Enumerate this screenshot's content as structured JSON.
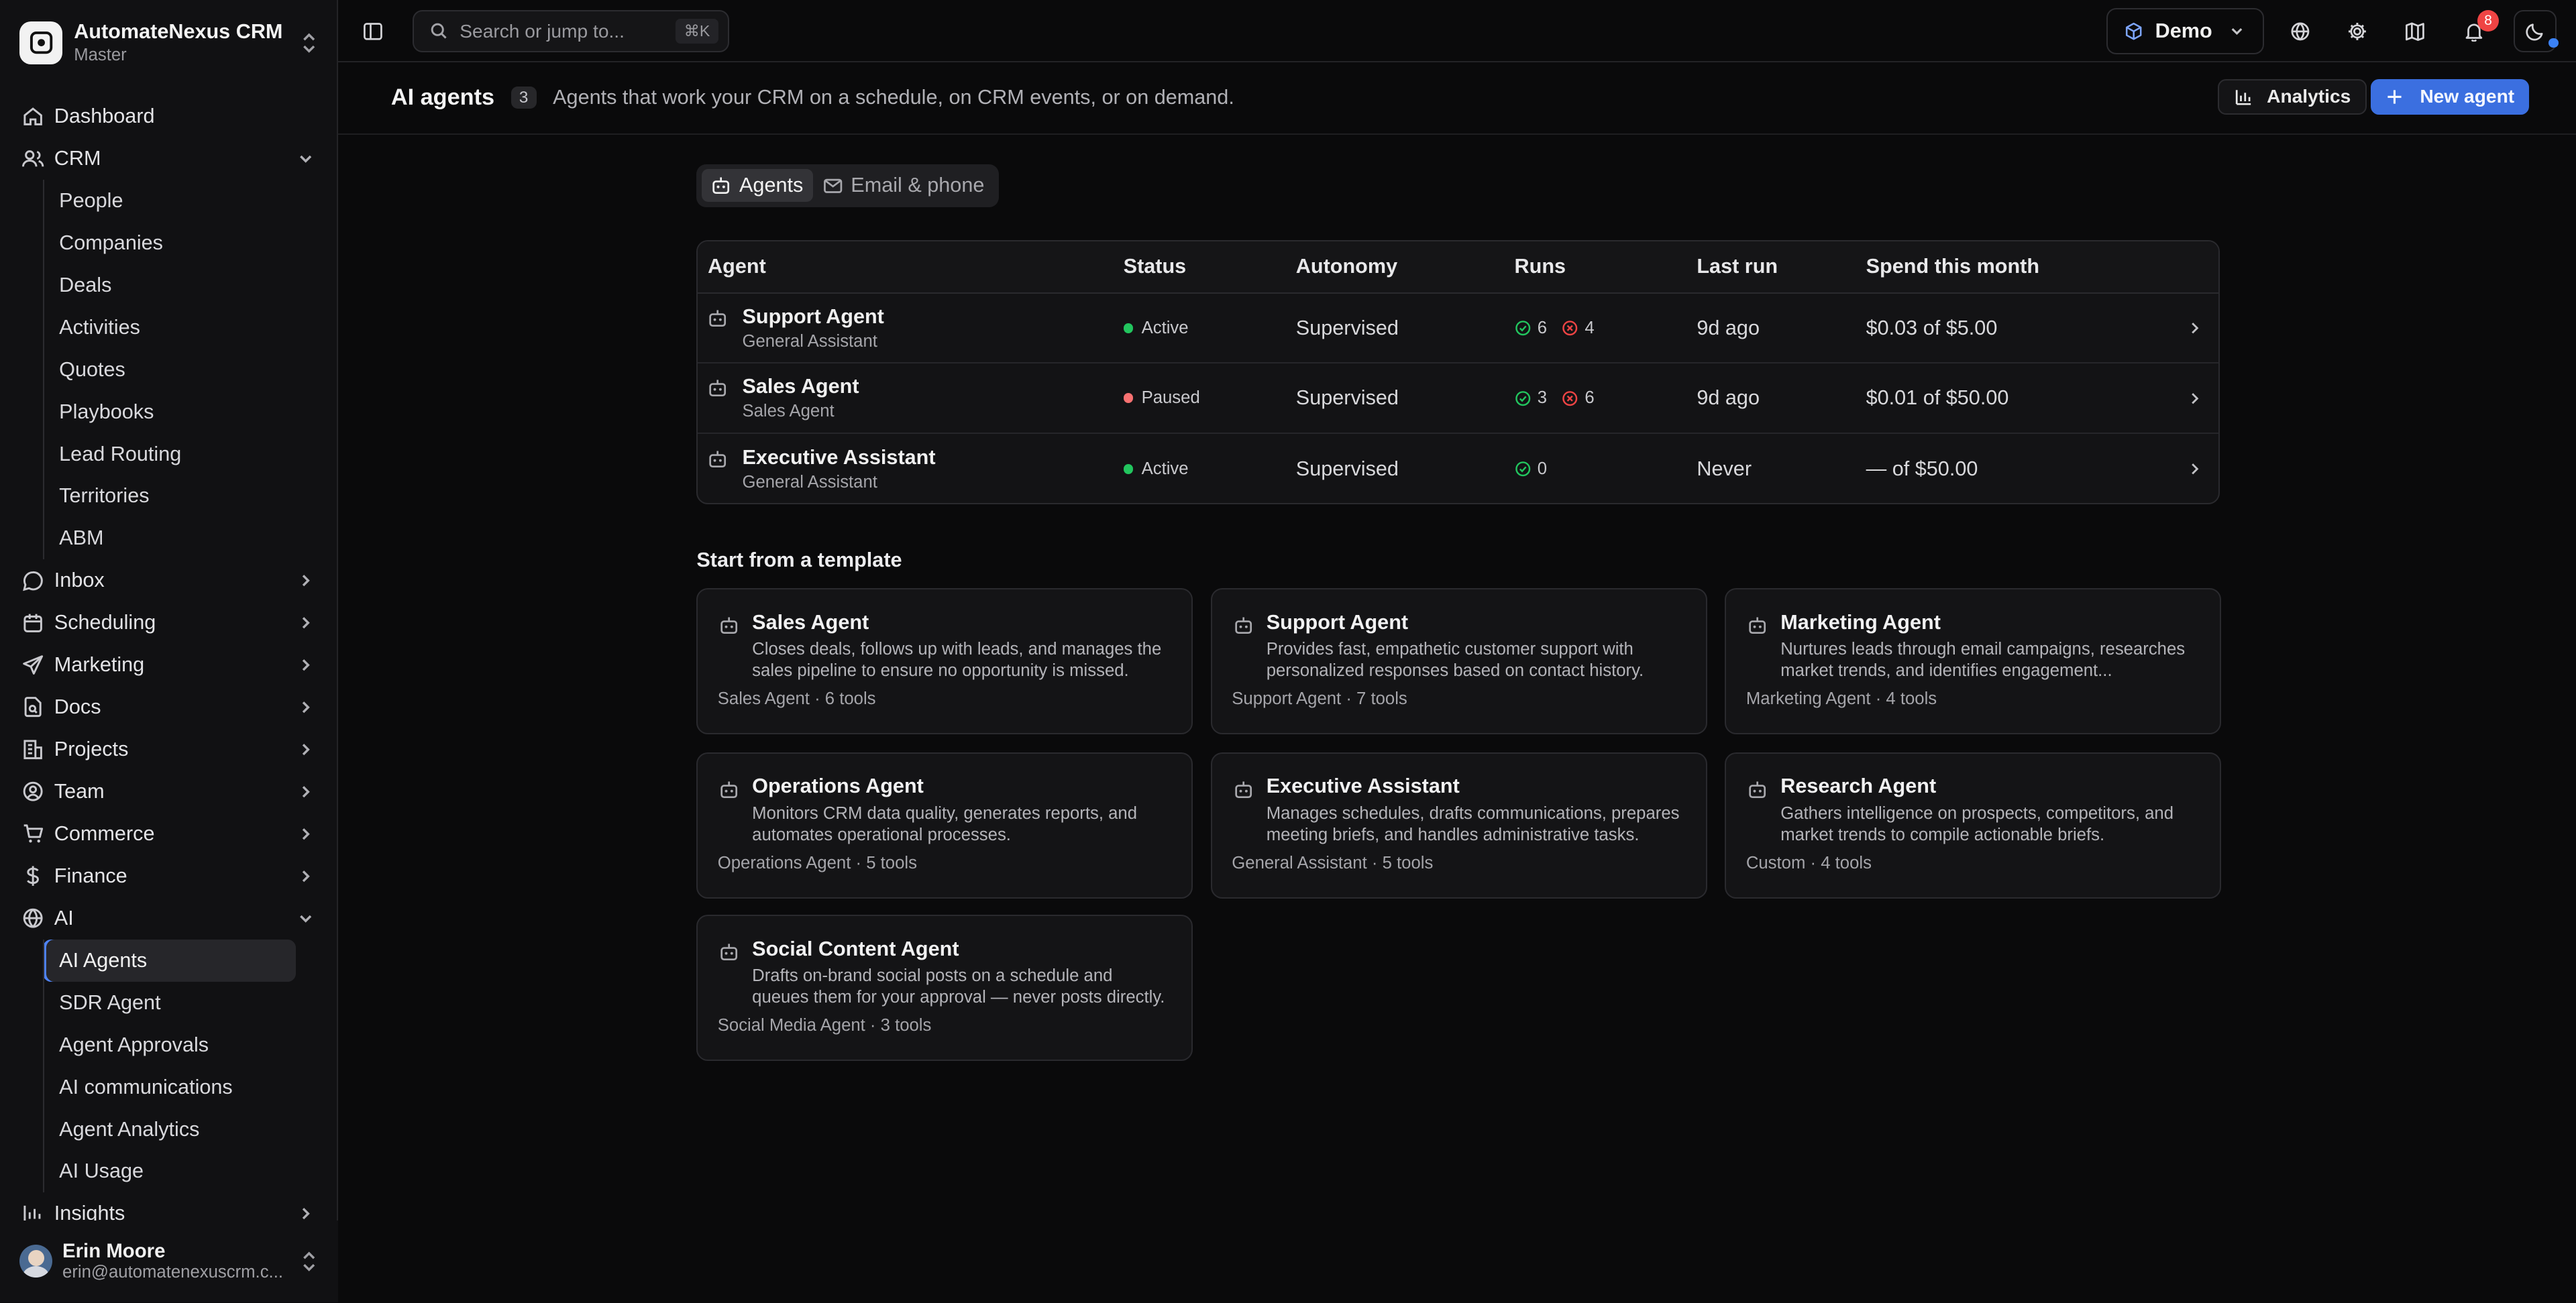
{
  "workspace": {
    "name": "AutomateNexus CRM",
    "sub": "Master"
  },
  "nav": {
    "dashboard": "Dashboard",
    "crm": "CRM",
    "crm_items": [
      "People",
      "Companies",
      "Deals",
      "Activities",
      "Quotes",
      "Playbooks",
      "Lead Routing",
      "Territories",
      "ABM"
    ],
    "inbox": "Inbox",
    "scheduling": "Scheduling",
    "marketing": "Marketing",
    "docs": "Docs",
    "projects": "Projects",
    "team": "Team",
    "commerce": "Commerce",
    "finance": "Finance",
    "ai": "AI",
    "ai_items": [
      "AI Agents",
      "SDR Agent",
      "Agent Approvals",
      "AI communications",
      "Agent Analytics",
      "AI Usage"
    ],
    "insights": "Insights"
  },
  "user": {
    "name": "Erin Moore",
    "email": "erin@automatenexuscrm.c..."
  },
  "topbar": {
    "search_placeholder": "Search or jump to...",
    "search_shortcut": "⌘K",
    "workspace_selector": "Demo",
    "notification_count": "8"
  },
  "page": {
    "title": "AI agents",
    "count": "3",
    "subtitle": "Agents that work your CRM on a schedule, on CRM events, or on demand.",
    "analytics_label": "Analytics",
    "new_agent_label": "New agent"
  },
  "tabs": [
    "Agents",
    "Email & phone"
  ],
  "table": {
    "headers": {
      "agent": "Agent",
      "status": "Status",
      "autonomy": "Autonomy",
      "runs": "Runs",
      "last_run": "Last run",
      "spend": "Spend this month"
    },
    "rows": [
      {
        "name": "Support Agent",
        "role": "General Assistant",
        "status": "Active",
        "status_color": "#22c55e",
        "autonomy": "Supervised",
        "runs_ok": "6",
        "runs_fail": "4",
        "last_run": "9d ago",
        "spend": "$0.03 of $5.00"
      },
      {
        "name": "Sales Agent",
        "role": "Sales Agent",
        "status": "Paused",
        "status_color": "#f87171",
        "autonomy": "Supervised",
        "runs_ok": "3",
        "runs_fail": "6",
        "last_run": "9d ago",
        "spend": "$0.01 of $50.00"
      },
      {
        "name": "Executive Assistant",
        "role": "General Assistant",
        "status": "Active",
        "status_color": "#22c55e",
        "autonomy": "Supervised",
        "runs_ok": "0",
        "runs_fail": "",
        "last_run": "Never",
        "spend": "— of $50.00"
      }
    ]
  },
  "templates": {
    "title": "Start from a template",
    "items": [
      {
        "name": "Sales Agent",
        "desc": "Closes deals, follows up with leads, and manages the sales pipeline to ensure no opportunity is missed.",
        "meta": "Sales Agent · 6 tools"
      },
      {
        "name": "Support Agent",
        "desc": "Provides fast, empathetic customer support with personalized responses based on contact history.",
        "meta": "Support Agent · 7 tools"
      },
      {
        "name": "Marketing Agent",
        "desc": "Nurtures leads through email campaigns, researches market trends, and identifies engagement...",
        "meta": "Marketing Agent · 4 tools"
      },
      {
        "name": "Operations Agent",
        "desc": "Monitors CRM data quality, generates reports, and automates operational processes.",
        "meta": "Operations Agent · 5 tools"
      },
      {
        "name": "Executive Assistant",
        "desc": "Manages schedules, drafts communications, prepares meeting briefs, and handles administrative tasks.",
        "meta": "General Assistant · 5 tools"
      },
      {
        "name": "Research Agent",
        "desc": "Gathers intelligence on prospects, competitors, and market trends to compile actionable briefs.",
        "meta": "Custom · 4 tools"
      },
      {
        "name": "Social Content Agent",
        "desc": "Drafts on-brand social posts on a schedule and queues them for your approval — never posts directly.",
        "meta": "Social Media Agent · 3 tools"
      }
    ]
  },
  "colors": {
    "accent": "#3b6fe0",
    "active": "#22c55e",
    "paused": "#f87171",
    "run_ok": "#22c55e",
    "run_fail": "#ef4444"
  }
}
